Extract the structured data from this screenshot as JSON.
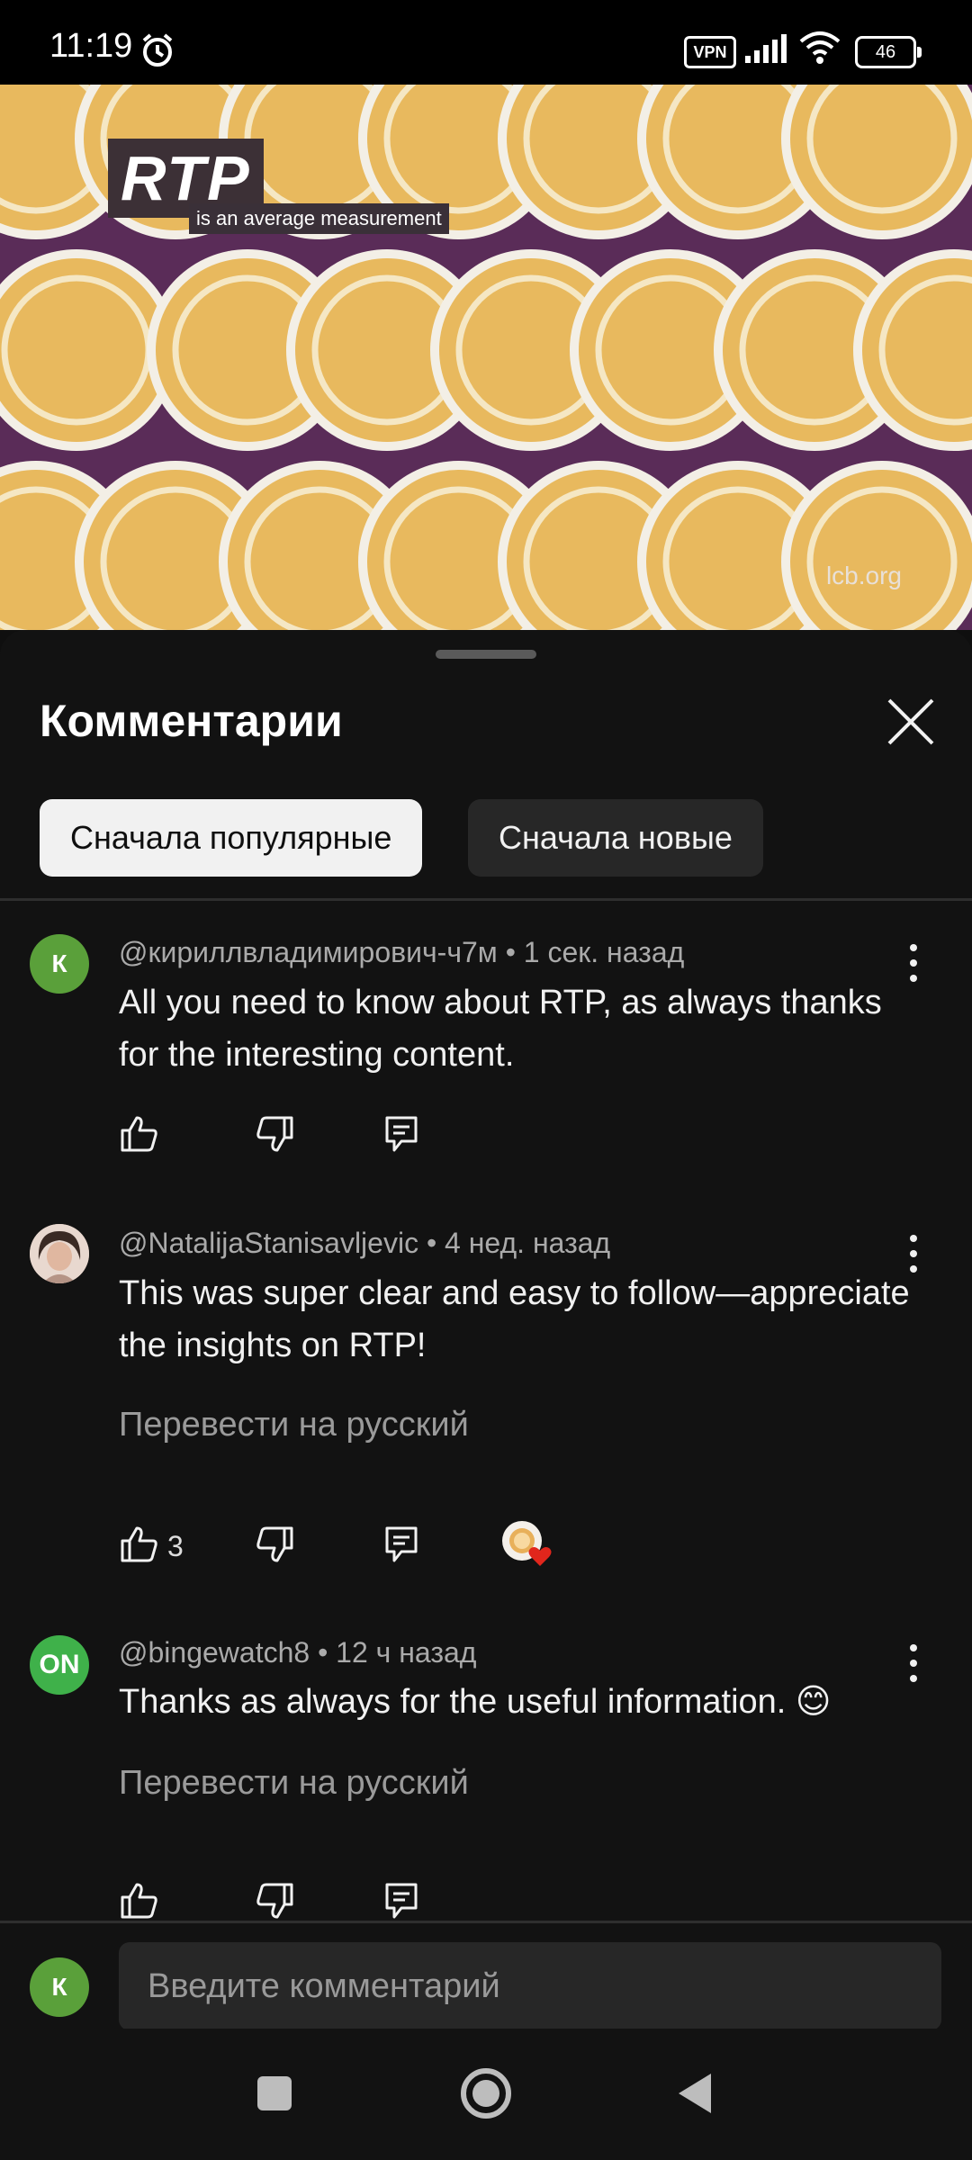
{
  "status_bar": {
    "time": "11:19",
    "vpn": "VPN",
    "battery": "46",
    "icons": [
      "alarm-icon",
      "signal-icon",
      "wifi-icon",
      "battery-icon"
    ]
  },
  "video": {
    "badge": "RTP",
    "subtitle": "is an average measurement",
    "watermark": "lcb.org",
    "progress_fraction": 0.17
  },
  "comments_panel": {
    "title": "Комментарии",
    "chips": [
      {
        "label": "Сначала популярные",
        "selected": true
      },
      {
        "label": "Сначала новые",
        "selected": false
      }
    ]
  },
  "comments": [
    {
      "avatar_letter": "К",
      "avatar_color": "#5aa03a",
      "author": "@кириллвладимирович-ч7м",
      "time": "• 1 сек. назад",
      "text": "All you need to know about RTP, as always thanks for the interesting content.",
      "likes": ""
    },
    {
      "avatar_letter": "",
      "avatar_color": "#c9a79a",
      "author": "@NatalijaStanisavljevic",
      "time": "• 4 нед. назад",
      "text": "This was super clear and easy to follow—appreciate the insights on RTP!",
      "translate": "Перевести на русский",
      "likes": "3",
      "creator_heart": true
    },
    {
      "avatar_letter": "ON",
      "avatar_color": "#3fb14a",
      "author": "@bingewatch8",
      "time": "• 12 ч назад",
      "text": "Thanks as always for the useful information. 😊",
      "translate": "Перевести на русский",
      "likes": ""
    }
  ],
  "comment_input": {
    "avatar_letter": "К",
    "placeholder": "Введите комментарий"
  },
  "navigation": {
    "icons": [
      "recents-icon",
      "home-icon",
      "back-icon"
    ]
  }
}
